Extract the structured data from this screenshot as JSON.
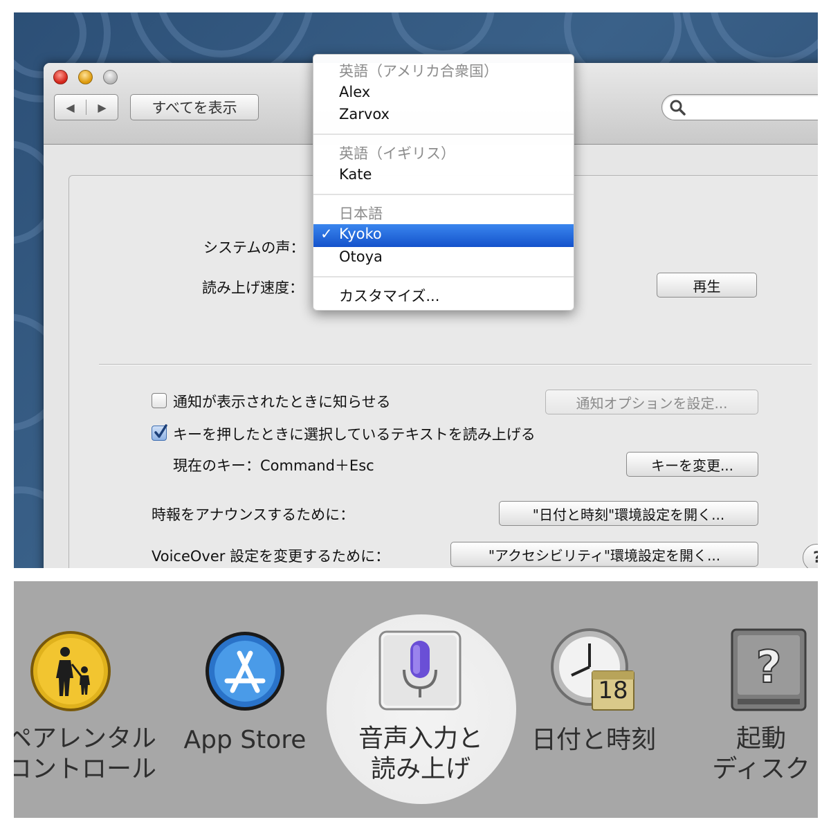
{
  "window": {
    "show_all": "すべてを表示",
    "nav_back": "◀",
    "nav_forward": "▶"
  },
  "search": {
    "placeholder": ""
  },
  "voice_menu": {
    "groups": [
      {
        "header": "英語（アメリカ合衆国）",
        "items": [
          "Alex",
          "Zarvox"
        ]
      },
      {
        "header": "英語（イギリス）",
        "items": [
          "Kate"
        ]
      },
      {
        "header": "日本語",
        "items": [
          "Kyoko",
          "Otoya"
        ]
      }
    ],
    "selected": "Kyoko",
    "check_mark": "✓",
    "customize": "カスタマイズ..."
  },
  "speech": {
    "system_voice_label": "システムの声：",
    "rate_label": "読み上げ速度：",
    "play_button": "再生",
    "notify_checkbox": {
      "label": "通知が表示されたときに知らせる",
      "checked": false
    },
    "notify_options_button": "通知オプションを設定...",
    "speak_selected_checkbox": {
      "label": "キーを押したときに選択しているテキストを読み上げる",
      "checked": true
    },
    "current_key": "現在のキー：Command＋Esc",
    "change_key_button": "キーを変更...",
    "announce_time_label": "時報をアナウンスするために：",
    "open_datetime_button": "\"日付と時刻\"環境設定を開く...",
    "voiceover_label": "VoiceOver 設定を変更するために：",
    "open_accessibility_button": "\"アクセシビリティ\"環境設定を開く...",
    "help_button": "?"
  },
  "preference_panes": [
    {
      "line1": "ペアレンタル",
      "line2": "コントロール",
      "icon": "parental-controls-icon"
    },
    {
      "line1": "App Store",
      "line2": "",
      "icon": "app-store-icon"
    },
    {
      "line1": "音声入力と",
      "line2": "読み上げ",
      "icon": "microphone-icon",
      "highlighted": true
    },
    {
      "line1": "日付と時刻",
      "line2": "",
      "icon": "clock-calendar-icon",
      "calendar_day": "18"
    },
    {
      "line1": "起動",
      "line2": "ディスク",
      "icon": "startup-disk-icon"
    }
  ],
  "colors": {
    "selection_blue": "#1f61d8",
    "wallpaper_blue": "#34587f",
    "bottom_bg": "#a7a7a7"
  }
}
